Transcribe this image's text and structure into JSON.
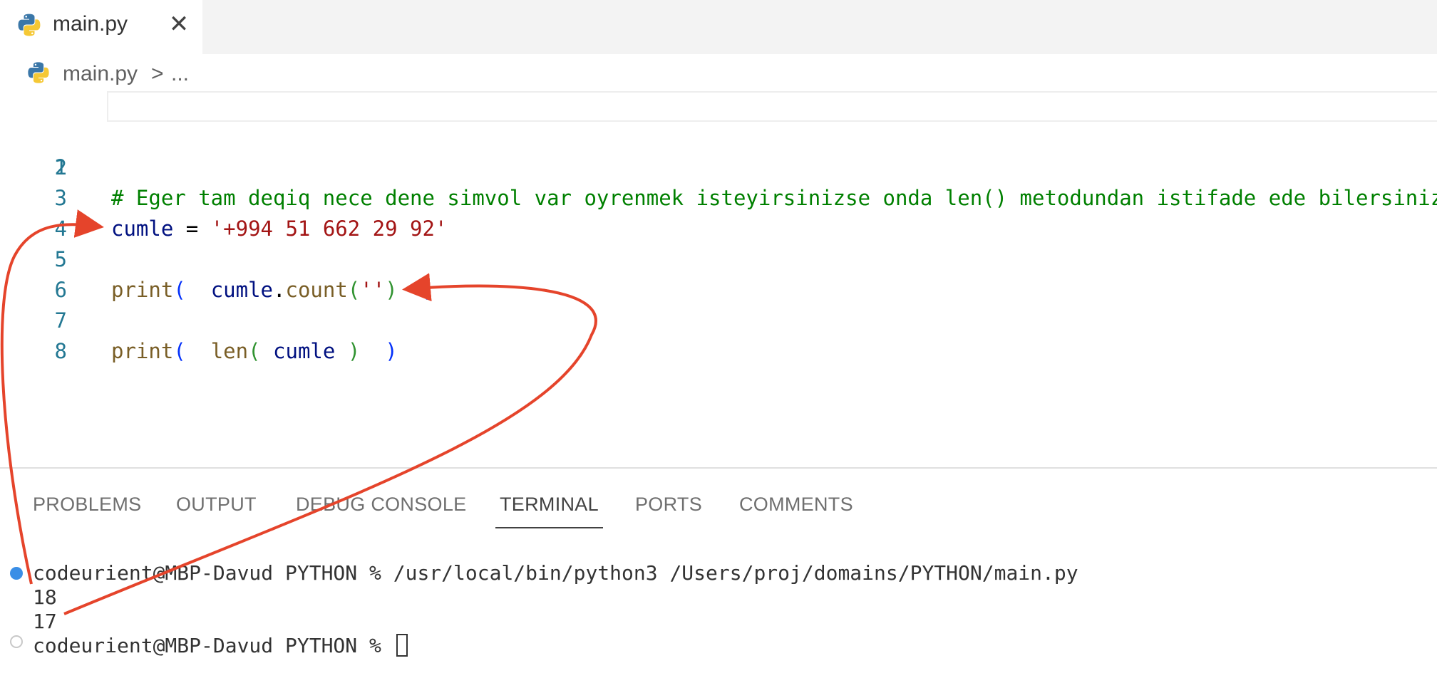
{
  "tab": {
    "label": "main.py",
    "close_icon": "close-icon",
    "file_icon": "python-icon"
  },
  "breadcrumb": {
    "file": "main.py",
    "separator": ">",
    "more": "..."
  },
  "editor": {
    "lines": [
      {
        "number": "1",
        "comment": "# Eger tam deqiq nece dene simvol var oyrenmek isteyirsinizse onda len() metodundan istifade ede bilersiniz"
      },
      {
        "number": "2"
      },
      {
        "number": "3",
        "var": "cumle",
        "op": " = ",
        "str": "'+994 51 662 29 92'"
      },
      {
        "number": "4"
      },
      {
        "number": "5",
        "func": "print",
        "open": "(",
        "var": "cumle",
        "dot": ".",
        "method": "count",
        "inner_open": "(",
        "str": "''",
        "inner_close": ")",
        "close": ")"
      },
      {
        "number": "6"
      },
      {
        "number": "7",
        "func": "print",
        "open": "(",
        "len": "len",
        "inner_open": "(",
        "var": "cumle",
        "inner_close": ")",
        "close": ")"
      },
      {
        "number": "8"
      }
    ]
  },
  "panel": {
    "tabs": [
      "PROBLEMS",
      "OUTPUT",
      "DEBUG CONSOLE",
      "TERMINAL",
      "PORTS",
      "COMMENTS"
    ],
    "active_tab": "TERMINAL"
  },
  "terminal": {
    "command_line": "codeurient@MBP-Davud PYTHON % /usr/local/bin/python3 /Users/proj/domains/PYTHON/main.py",
    "output": [
      "18",
      "17"
    ],
    "prompt": "codeurient@MBP-Davud PYTHON % "
  },
  "colors": {
    "arrow": "#e5442b",
    "accent_dot": "#3a8ee6"
  }
}
